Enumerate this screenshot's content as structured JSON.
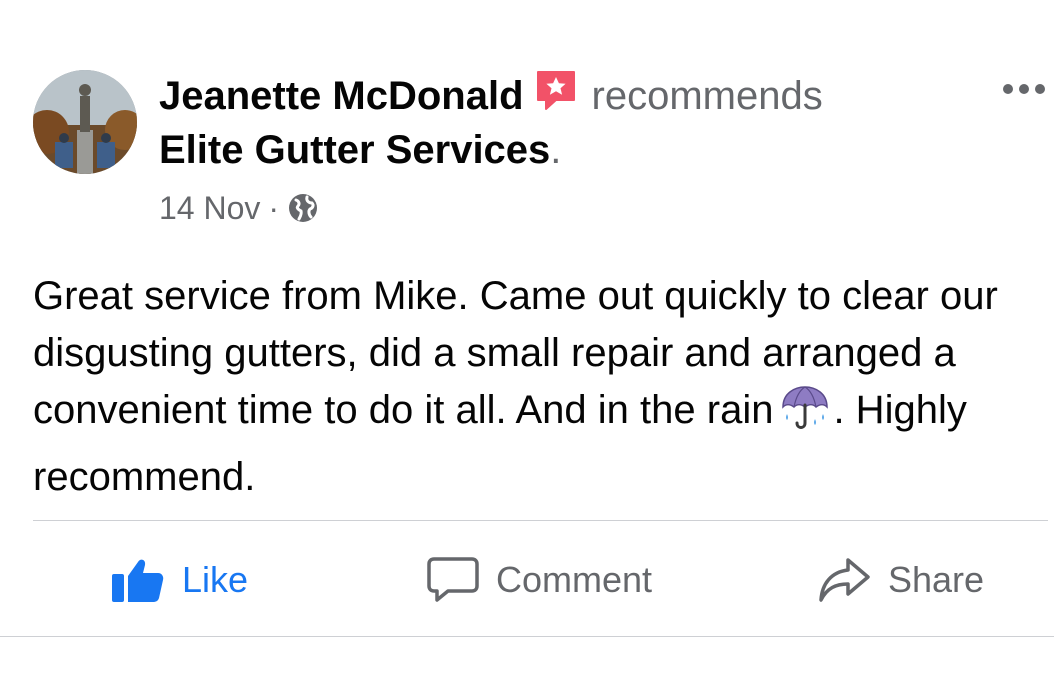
{
  "post": {
    "author": "Jeanette McDonald",
    "verb": "recommends",
    "page_name": "Elite Gutter Services",
    "page_suffix": ".",
    "date": "14 Nov",
    "separator": "·",
    "privacy_icon": "globe-icon",
    "badge_icon": "recommendation-star-icon",
    "text_before_emoji": "Great service from Mike. Came out quickly to clear our disgusting gutters, did a small repair and arranged a convenient time to do it all. And in the rain",
    "emoji": "umbrella-with-rain-icon",
    "text_after_emoji": ". Highly recommend."
  },
  "actions": {
    "like": "Like",
    "comment": "Comment",
    "share": "Share"
  },
  "colors": {
    "like_blue": "#1877f2",
    "secondary_text": "#65676b",
    "badge_pink": "#f25268",
    "divider": "#ced0d4"
  }
}
